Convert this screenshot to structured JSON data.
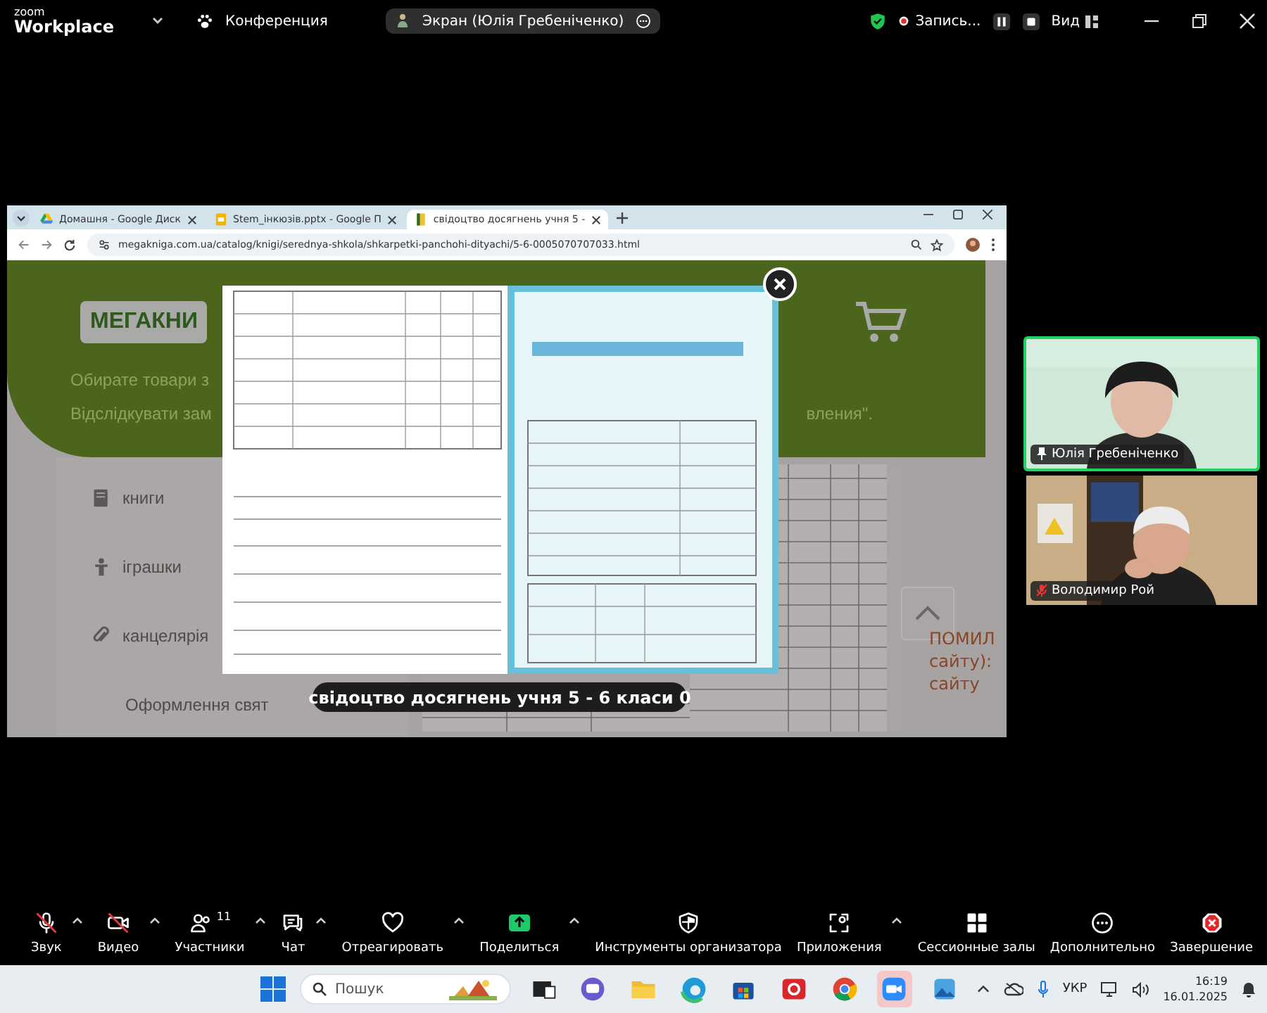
{
  "app_bar": {
    "logo_top": "zoom",
    "logo_bottom": "Workplace",
    "meeting": "Конференция",
    "share_pill": "Экран (Юлія Гребеніченко)",
    "recording": "Запись...",
    "view": "Вид"
  },
  "browser": {
    "tabs": [
      {
        "label": "Домашня - Google Диск",
        "selected": false
      },
      {
        "label": "Stem_інкюзів.pptx - Google П",
        "selected": false
      },
      {
        "label": "свідоцтво досягнень учня 5 -",
        "selected": true
      }
    ],
    "url": "megakniga.com.ua/catalog/knigi/serednya-shkola/shkarpetki-panchohi-dityachi/5-6-0005070707033.html"
  },
  "page": {
    "logo": "МЕГАКНИ",
    "line_1": "Обирате товари з",
    "line_2": "Відслідкувати зам",
    "line_2_tail": "вления\".",
    "menu": [
      "книги",
      "іграшки",
      "канцелярія",
      "Оформлення свят"
    ],
    "side_note": [
      "ПОМИЛ",
      "сайту):",
      "сайту"
    ]
  },
  "lightbox": {
    "caption": "свідоцтво досягнень учня 5 - 6 класи 0"
  },
  "participants": [
    {
      "name": "Юлія Гребеніченко",
      "pinned": true,
      "muted": false,
      "active_speaker": true
    },
    {
      "name": "Володимир Рой",
      "pinned": false,
      "muted": true,
      "active_speaker": false
    }
  ],
  "toolbar": [
    {
      "label": "Звук",
      "off": true,
      "caret": true
    },
    {
      "label": "Видео",
      "off": true,
      "caret": true
    },
    {
      "label": "Участники",
      "count": "11",
      "off": false,
      "caret": true
    },
    {
      "label": "Чат",
      "off": false,
      "caret": true
    },
    {
      "label": "Отреагировать",
      "off": false,
      "caret": true
    },
    {
      "label": "Поделиться",
      "off": false,
      "caret": true
    },
    {
      "label": "Инструменты организатора",
      "off": false,
      "caret": false
    },
    {
      "label": "Приложения",
      "off": false,
      "caret": true
    },
    {
      "label": "Сессионные залы",
      "off": false,
      "caret": false
    },
    {
      "label": "Дополнительно",
      "off": false,
      "caret": false
    },
    {
      "label": "Завершение",
      "off": false,
      "caret": false
    }
  ],
  "taskbar": {
    "search_placeholder": "Пошук",
    "apps": [
      {
        "kind": "taskview",
        "selected": false
      },
      {
        "kind": "chat",
        "selected": false
      },
      {
        "kind": "explorer",
        "selected": false
      },
      {
        "kind": "edge",
        "selected": false
      },
      {
        "kind": "store",
        "selected": false
      },
      {
        "kind": "redapp",
        "selected": false
      },
      {
        "kind": "chrome",
        "selected": false
      },
      {
        "kind": "zoom",
        "selected": true
      },
      {
        "kind": "photos",
        "selected": false
      }
    ],
    "lang": "УКР",
    "time": "16:19",
    "date": "16.01.2025"
  }
}
